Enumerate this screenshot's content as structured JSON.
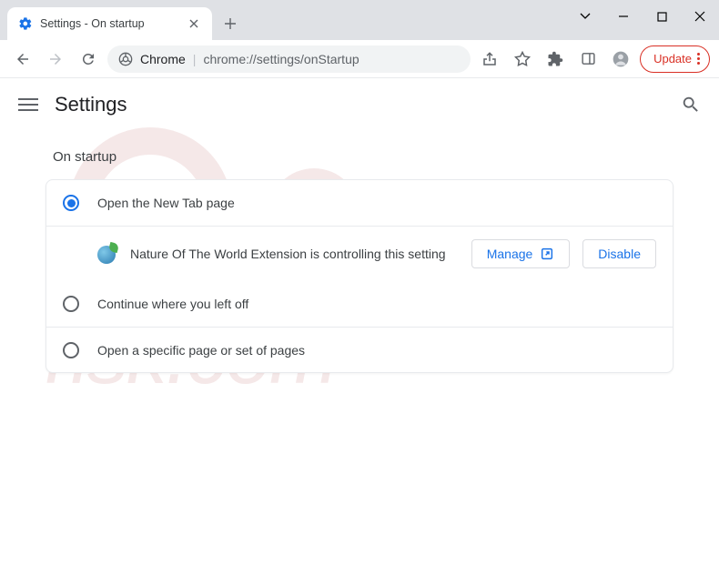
{
  "tab": {
    "title": "Settings - On startup"
  },
  "omnibox": {
    "prefix": "Chrome",
    "url": "chrome://settings/onStartup"
  },
  "updateButton": {
    "label": "Update"
  },
  "app": {
    "title": "Settings"
  },
  "section": {
    "title": "On startup"
  },
  "options": {
    "opt1": "Open the New Tab page",
    "opt2": "Continue where you left off",
    "opt3": "Open a specific page or set of pages"
  },
  "extension": {
    "message": "Nature Of The World Extension is controlling this setting",
    "manage": "Manage",
    "disable": "Disable"
  }
}
